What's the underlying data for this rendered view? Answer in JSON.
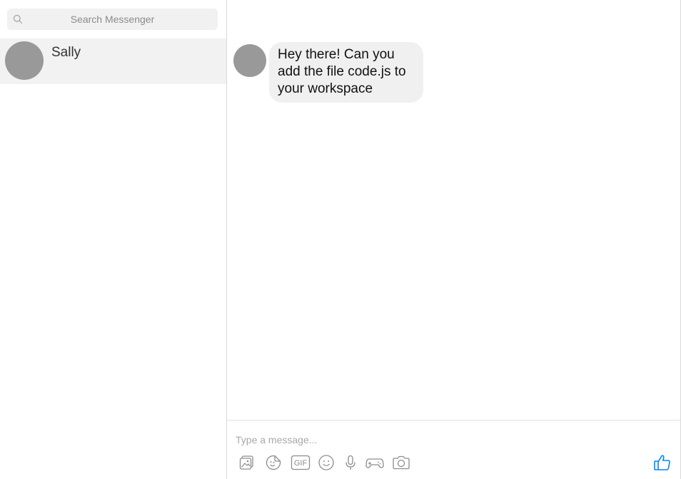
{
  "search": {
    "placeholder": "Search Messenger",
    "icon": "search-icon"
  },
  "conversations": [
    {
      "name": "Sally",
      "avatar_color": "#999999",
      "selected": true
    }
  ],
  "chat": {
    "messages": [
      {
        "sender": "Sally",
        "text": "Hey there! Can you add the file code.js to your workspace"
      }
    ],
    "bubble_color": "#f1f0f0"
  },
  "composer": {
    "placeholder": "Type a message...",
    "tools": [
      "photo-icon",
      "sticker-icon",
      "gif-icon",
      "emoji-icon",
      "microphone-icon",
      "game-controller-icon",
      "camera-icon"
    ],
    "gif_label": "GIF",
    "like_icon": "thumbs-up-icon",
    "accent_color": "#0084ff"
  }
}
